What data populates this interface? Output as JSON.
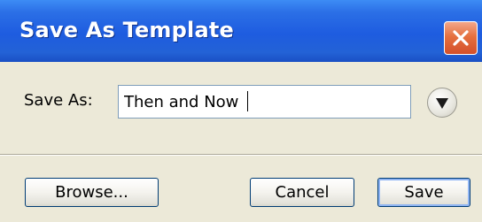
{
  "dialog": {
    "title": "Save As Template",
    "close_icon": "close-icon",
    "save_as_label": "Save As:",
    "name_value": "Then and Now",
    "dropdown_icon": "chevron-down-icon",
    "browse_label": "Browse...",
    "cancel_label": "Cancel",
    "save_label": "Save"
  },
  "colors": {
    "titlebar": "#1e5ce0",
    "close": "#e5703f",
    "background": "#ece9d8",
    "button_border": "#003c74"
  }
}
